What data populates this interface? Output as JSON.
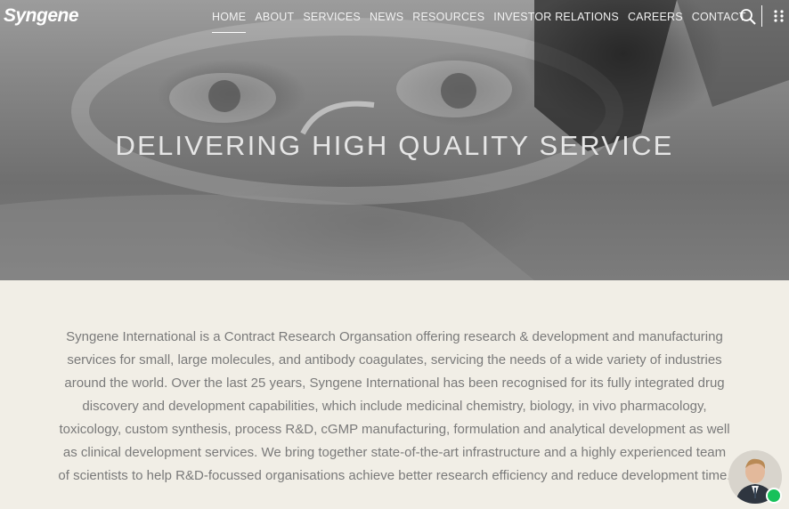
{
  "brand": {
    "logo_text": "Syngene"
  },
  "nav": {
    "items": [
      {
        "label": "HOME",
        "active": true
      },
      {
        "label": "ABOUT"
      },
      {
        "label": "SERVICES"
      },
      {
        "label": "NEWS"
      },
      {
        "label": "RESOURCES"
      },
      {
        "label": "INVESTOR RELATIONS"
      },
      {
        "label": "CAREERS"
      },
      {
        "label": "CONTACT"
      }
    ],
    "search_icon": "search-icon",
    "apps_icon": "grid-dots-icon"
  },
  "hero": {
    "title": "DELIVERING HIGH QUALITY SERVICE"
  },
  "intro": {
    "text": "Syngene International is a Contract Research Organsation offering research & development and manufacturing services for small, large molecules, and antibody coagulates, servicing the needs of a wide variety of industries around the world. Over the last 25 years, Syngene International has been recognised for its fully integrated drug discovery and development capabilities, which include medicinal chemistry, biology, in vivo pharmacology, toxicology, custom synthesis, process R&D, cGMP manufacturing, formulation and analytical development as well as clinical development services. We bring together state-of-the-art infrastructure and a highly experienced team of scientists to help R&D-focussed organisations achieve better research efficiency and reduce development time."
  },
  "chat": {
    "avatar_icon": "agent-avatar",
    "status": "online",
    "status_color": "#18c15a"
  },
  "colors": {
    "page_bg": "#f1eee6",
    "body_text": "#7a7a7a",
    "nav_text": "#f2f2f2"
  }
}
